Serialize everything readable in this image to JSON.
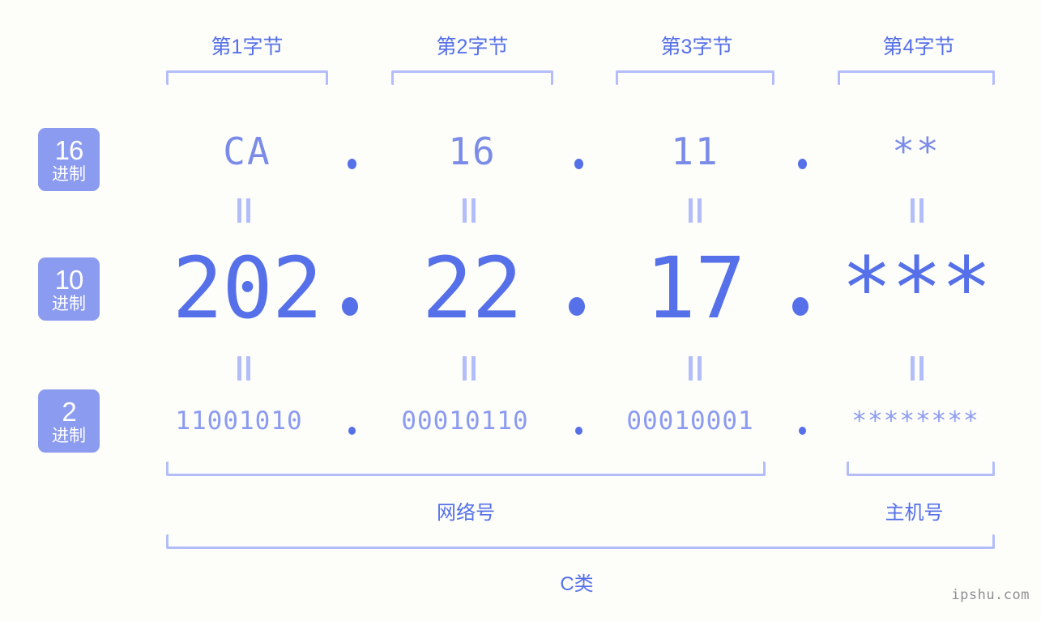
{
  "byte_headers": [
    {
      "label": "第1字节"
    },
    {
      "label": "第2字节"
    },
    {
      "label": "第3字节"
    },
    {
      "label": "第4字节"
    }
  ],
  "bases": [
    {
      "num": "16",
      "unit": "进制"
    },
    {
      "num": "10",
      "unit": "进制"
    },
    {
      "num": "2",
      "unit": "进制"
    }
  ],
  "rows": {
    "hex": {
      "values": [
        "CA",
        "16",
        "11",
        "**"
      ]
    },
    "decimal": {
      "values": [
        "202",
        "22",
        "17",
        "***"
      ]
    },
    "binary": {
      "values": [
        "11001010",
        "00010110",
        "00010001",
        "********"
      ]
    }
  },
  "separator": ".",
  "equals_mark": "=",
  "sections": {
    "network": "网络号",
    "host": "主机号",
    "class": "C类"
  },
  "watermark": "ipshu.com",
  "colors": {
    "background": "#fdfdfa",
    "accent_strong": "#5570e8",
    "accent_mid": "#7b8ce8",
    "accent_light": "#8b9bf0",
    "bracket": "#b3bdfa",
    "badge_bg": "#8b9bf0",
    "badge_text": "#ffffff",
    "watermark": "#8f8f93"
  }
}
